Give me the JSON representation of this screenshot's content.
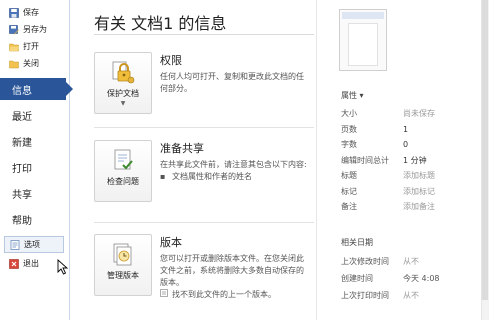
{
  "nav": {
    "top_items": [
      {
        "label": "保存",
        "icon": "save-icon"
      },
      {
        "label": "另存为",
        "icon": "save-as-icon"
      },
      {
        "label": "打开",
        "icon": "open-folder-icon"
      },
      {
        "label": "关闭",
        "icon": "close-folder-icon"
      }
    ],
    "items": [
      "信息",
      "最近",
      "新建",
      "打印",
      "共享",
      "帮助"
    ],
    "active": "信息",
    "bottom_items": [
      {
        "label": "选项",
        "icon": "options-icon"
      },
      {
        "label": "退出",
        "icon": "exit-icon"
      }
    ]
  },
  "main": {
    "title": "有关 文档1 的信息",
    "sections": [
      {
        "button_label": "保护文档",
        "has_caret": true,
        "icon": "lock-key-icon",
        "heading": "权限",
        "description": "任何人均可打开、复制和更改此文档的任何部分。"
      },
      {
        "button_label": "检查问题",
        "has_caret": false,
        "icon": "check-document-icon",
        "heading": "准备共享",
        "description": "在共享此文件前，请注意其包含以下内容:",
        "bullet": "文档属性和作者的姓名"
      },
      {
        "button_label": "管理版本",
        "has_caret": false,
        "icon": "manage-versions-icon",
        "heading": "版本",
        "description": "您可以打开或删除版本文件。在您关闭此文件之前，系统将删除大多数自动保存的版本。",
        "bullet": "找不到此文件的上一个版本。"
      }
    ]
  },
  "properties": {
    "heading": "属性 ▾",
    "rows": [
      {
        "key": "大小",
        "value": "尚未保存",
        "muted": true
      },
      {
        "key": "页数",
        "value": "1",
        "muted": false
      },
      {
        "key": "字数",
        "value": "0",
        "muted": false
      },
      {
        "key": "编辑时间总计",
        "value": "1 分钟",
        "muted": false
      },
      {
        "key": "标题",
        "value": "添加标题",
        "muted": true
      },
      {
        "key": "标记",
        "value": "添加标记",
        "muted": true
      },
      {
        "key": "备注",
        "value": "添加备注",
        "muted": true
      }
    ]
  },
  "dates": {
    "heading": "相关日期",
    "rows": [
      {
        "key": "上次修改时间",
        "value": "从不",
        "dark": false
      },
      {
        "key": "创建时间",
        "value": "今天 4:08",
        "dark": true
      },
      {
        "key": "上次打印时间",
        "value": "从不",
        "dark": false
      }
    ]
  },
  "colors": {
    "accent": "#2a5699"
  }
}
